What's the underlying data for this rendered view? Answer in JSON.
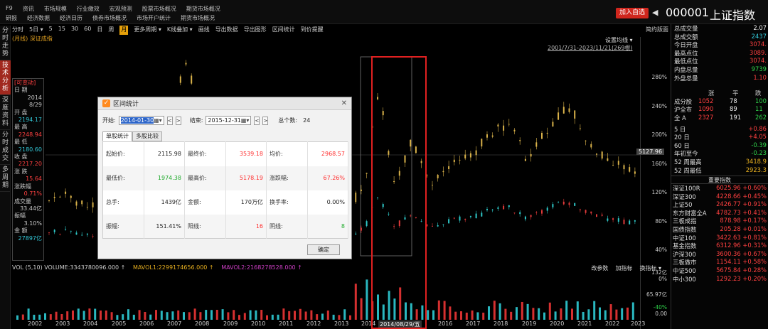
{
  "topnav": {
    "row1": [
      "F9",
      "资讯",
      "市场规模",
      "行业缴效",
      "宏观预测",
      "股票市场概况",
      "期货市场概况"
    ],
    "row2": [
      "研报",
      "经济数据",
      "经济日历",
      "债券市场概况",
      "市场开户统计",
      "期货市场概况"
    ],
    "add_fav": "加入自选",
    "stock_code": "000001",
    "stock_name": "上证指数"
  },
  "left_tabs": [
    {
      "label": "分时走势",
      "active": false
    },
    {
      "label": "技术分析",
      "active": true
    },
    {
      "label": "深度资料",
      "active": false
    },
    {
      "label": "分时成交",
      "active": false
    },
    {
      "label": "多周期",
      "active": false
    }
  ],
  "toolbar": {
    "items": [
      "分时",
      "5日 ▾",
      "5",
      "15",
      "30",
      "60",
      "日",
      "周",
      "月",
      "更多周期 ▾",
      "K线叠加 ▾",
      "画线",
      "导出数据",
      "导出图形",
      "区间统计",
      "到价提醒"
    ],
    "active_index": 8,
    "right_label": "简约版面"
  },
  "subline": "(月线) 深证成指",
  "chart_note": {
    "settings": "设置均线 ▾",
    "range": "2001/7/31-2023/11/21(269根)"
  },
  "info_column": [
    {
      "text": "[可变动]",
      "style": "tag"
    },
    {
      "text": "日 期",
      "style": "label"
    },
    {
      "text": "2014",
      "style": "val"
    },
    {
      "text": "8/29",
      "style": "val"
    },
    {
      "text": "开 盘",
      "style": "label"
    },
    {
      "text": "2194.17",
      "style": "cyan"
    },
    {
      "text": "最 高",
      "style": "label"
    },
    {
      "text": "2248.94",
      "style": "red"
    },
    {
      "text": "最 低",
      "style": "label"
    },
    {
      "text": "2180.60",
      "style": "cyan"
    },
    {
      "text": "收 盘",
      "style": "label"
    },
    {
      "text": "2217.20",
      "style": "red"
    },
    {
      "text": "涨 跌",
      "style": "label"
    },
    {
      "text": "15.64",
      "style": "red"
    },
    {
      "text": "涨跌幅",
      "style": "label"
    },
    {
      "text": "0.71%",
      "style": "red"
    },
    {
      "text": "成交量",
      "style": "label"
    },
    {
      "text": "33.44亿",
      "style": "val"
    },
    {
      "text": "振幅",
      "style": "label"
    },
    {
      "text": "3.10%",
      "style": "val"
    },
    {
      "text": "金 额",
      "style": "label"
    },
    {
      "text": "27897亿",
      "style": "cyan"
    }
  ],
  "y_ticks": [
    {
      "label": "280%",
      "neg": false
    },
    {
      "label": "240%",
      "neg": false
    },
    {
      "label": "200%",
      "neg": false
    },
    {
      "label": "160%",
      "neg": false
    },
    {
      "label": "120%",
      "neg": false
    },
    {
      "label": "80%",
      "neg": false
    },
    {
      "label": "40%",
      "neg": false
    },
    {
      "label": "0%",
      "neg": false
    },
    {
      "label": "-40%",
      "neg": true
    }
  ],
  "price_tag": "5127.96",
  "vol_ticks": [
    "132亿",
    "65.97亿",
    "0.00"
  ],
  "volume_bar": {
    "vol": "VOL (5,10) VOLUME:3343780096.000 ↑",
    "mavol1": "MAVOL1:2299174656.000 ↑",
    "mavol2": "MAVOL2:2168278528.000 ↑",
    "right_items": [
      "改参数",
      "加指标",
      "换指标 ▾"
    ]
  },
  "x_labels": [
    "2002",
    "2003",
    "2004",
    "2005",
    "2006",
    "2007",
    "2008",
    "2009",
    "2010",
    "2011",
    "2012",
    "2013",
    "2014",
    "2014/08/29/五",
    "2016",
    "2017",
    "2018",
    "2019",
    "2020",
    "2021",
    "2022",
    "2023"
  ],
  "right_panel": {
    "quote": [
      {
        "label": "总成交量",
        "value": "2.07",
        "color": "white"
      },
      {
        "label": "总成交额",
        "value": "2437",
        "color": "cyan"
      },
      {
        "label": "今日开盘",
        "value": "3074.",
        "color": "red"
      },
      {
        "label": "最高点位",
        "value": "3089.",
        "color": "red"
      },
      {
        "label": "最低点位",
        "value": "3074.",
        "color": "red"
      },
      {
        "label": "内盘总量",
        "value": "9739",
        "color": "green"
      },
      {
        "label": "外盘总量",
        "value": "1.10",
        "color": "red"
      }
    ],
    "breadth_head": [
      "涨",
      "平",
      "跌"
    ],
    "breadth": [
      {
        "label": "成分股",
        "up": "1052",
        "flat": "78",
        "down": "100"
      },
      {
        "label": "沪全市",
        "up": "1090",
        "flat": "89",
        "down": "11"
      },
      {
        "label": "全 A",
        "up": "2327",
        "flat": "191",
        "down": "262"
      }
    ],
    "periods": [
      {
        "label": "5 日",
        "value": "+0.86",
        "color": "red"
      },
      {
        "label": "20 日",
        "value": "+4.05",
        "color": "red"
      },
      {
        "label": "60 日",
        "value": "-0.39",
        "color": "green"
      },
      {
        "label": "年初至今",
        "value": "-0.23",
        "color": "green"
      },
      {
        "label": "52 周最高",
        "value": "3418.9",
        "color": "yellow"
      },
      {
        "label": "52 周最低",
        "value": "2923.3",
        "color": "yellow"
      }
    ],
    "indices_head": "重要指数",
    "indices": [
      {
        "name": "深证100R",
        "value": "6025.96 +0.60%"
      },
      {
        "name": "深证300",
        "value": "4228.66 +0.45%"
      },
      {
        "name": "上证50",
        "value": "2426.77 +0.91%"
      },
      {
        "name": "东方财富全A",
        "value": "4782.73 +0.41%"
      },
      {
        "name": "三板成指",
        "value": "878.98 +0.17%"
      },
      {
        "name": "国债指数",
        "value": "205.28 +0.01%"
      },
      {
        "name": "中证100",
        "value": "3422.63 +0.81%"
      },
      {
        "name": "基金指数",
        "value": "6312.96 +0.31%"
      },
      {
        "name": "沪深300",
        "value": "3600.36 +0.67%"
      },
      {
        "name": "三板做市",
        "value": "1154.11 +0.58%"
      },
      {
        "name": "中证500",
        "value": "5675.84 +0.28%"
      },
      {
        "name": "中小300",
        "value": "1292.23 +0.20%"
      }
    ]
  },
  "dialog": {
    "title": "区间统计",
    "start_label": "开始:",
    "start_value": "2014-01-30",
    "end_label": "结束:",
    "end_value": "2015-12-31",
    "count_label": "总个数:",
    "count_value": "24",
    "tabs": [
      "单股统计",
      "多股比较"
    ],
    "rows": [
      [
        {
          "l": "起始价:",
          "v": "2115.98",
          "c": ""
        },
        {
          "l": "最终价:",
          "v": "3539.18",
          "c": "red"
        },
        {
          "l": "均价:",
          "v": "2968.57",
          "c": "red"
        }
      ],
      [
        {
          "l": "最低价:",
          "v": "1974.38",
          "c": "green"
        },
        {
          "l": "最高价:",
          "v": "5178.19",
          "c": "red"
        },
        {
          "l": "涨跌幅:",
          "v": "67.26%",
          "c": "red"
        }
      ],
      [
        {
          "l": "总手:",
          "v": "1439亿",
          "c": ""
        },
        {
          "l": "金额:",
          "v": "170万亿",
          "c": ""
        },
        {
          "l": "换手率:",
          "v": "0.00%",
          "c": ""
        }
      ],
      [
        {
          "l": "振幅:",
          "v": "151.41%",
          "c": ""
        },
        {
          "l": "阳线:",
          "v": "16",
          "c": "red"
        },
        {
          "l": "阴线:",
          "v": "8",
          "c": "green"
        }
      ]
    ],
    "ok_label": "确定"
  }
}
